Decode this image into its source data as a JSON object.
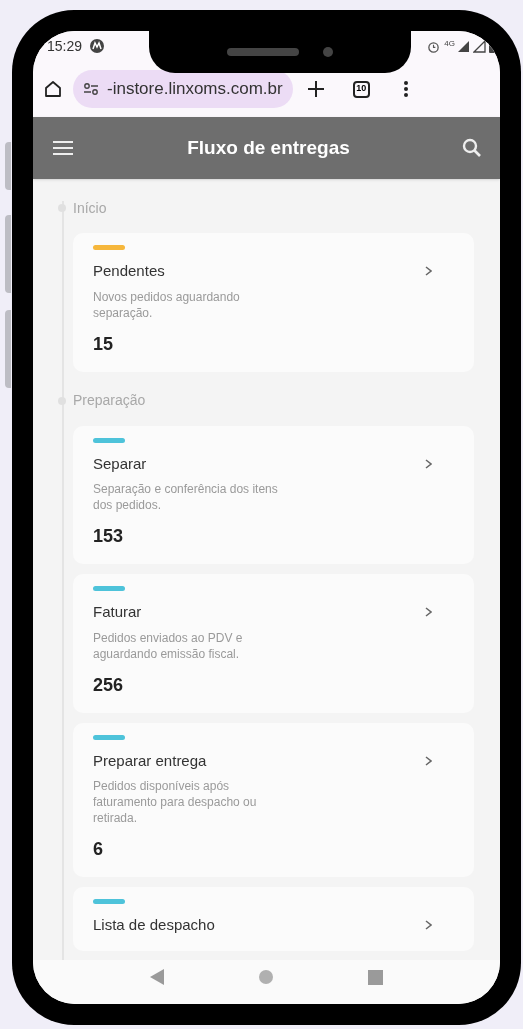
{
  "status_bar": {
    "time": "15:29",
    "network": "4G"
  },
  "browser": {
    "url": "-instore.linxoms.com.br",
    "tab_count": "10"
  },
  "app_bar": {
    "title": "Fluxo de entregas"
  },
  "sections": [
    {
      "title": "Início",
      "cards": [
        {
          "title": "Pendentes",
          "description": "Novos pedidos aguardando separação.",
          "count": "15",
          "color": "#f6b73c"
        }
      ]
    },
    {
      "title": "Preparação",
      "cards": [
        {
          "title": "Separar",
          "description": "Separação e conferência dos itens dos pedidos.",
          "count": "153",
          "color": "#4ec3da"
        },
        {
          "title": "Faturar",
          "description": "Pedidos enviados ao PDV e aguardando emissão fiscal.",
          "count": "256",
          "color": "#4ec3da"
        },
        {
          "title": "Preparar entrega",
          "description": "Pedidos disponíveis após faturamento para despacho ou retirada.",
          "count": "6",
          "color": "#4ec3da"
        },
        {
          "title": "Lista de despacho",
          "color": "#4ec3da"
        }
      ]
    }
  ]
}
